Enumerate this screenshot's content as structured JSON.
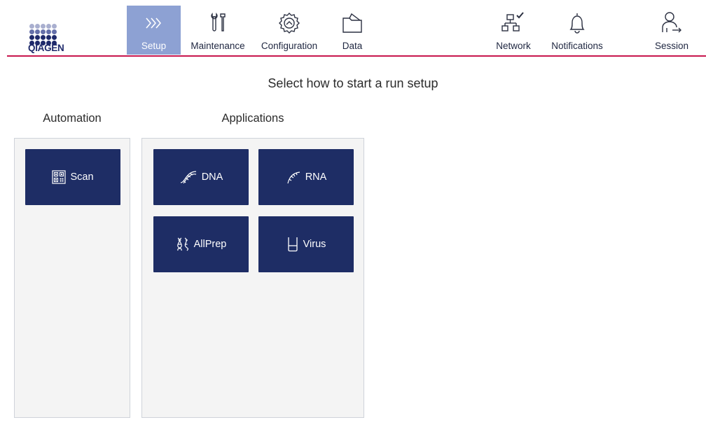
{
  "brand": {
    "name": "QIAGEN",
    "accent_color": "#c8174e",
    "primary_color": "#1e2d65",
    "active_nav_color": "#8da1d3"
  },
  "nav": {
    "setup": {
      "label": "Setup",
      "icon": "chevrons-right-icon"
    },
    "maintenance": {
      "label": "Maintenance",
      "icon": "tools-icon"
    },
    "configuration": {
      "label": "Configuration",
      "icon": "gear-icon"
    },
    "data": {
      "label": "Data",
      "icon": "folder-icon"
    },
    "network": {
      "label": "Network",
      "icon": "network-connected-icon"
    },
    "notifications": {
      "label": "Notifications",
      "icon": "bell-icon"
    },
    "session": {
      "label": "Session",
      "icon": "user-logout-icon"
    }
  },
  "main": {
    "title": "Select how to start a run setup",
    "automation": {
      "heading": "Automation",
      "tiles": [
        {
          "label": "Scan",
          "icon": "qr-code-icon"
        }
      ]
    },
    "applications": {
      "heading": "Applications",
      "tiles": [
        {
          "label": "DNA",
          "icon": "dna-helix-icon"
        },
        {
          "label": "RNA",
          "icon": "rna-strand-icon"
        },
        {
          "label": "AllPrep",
          "icon": "dna-rna-icon"
        },
        {
          "label": "Virus",
          "icon": "test-tube-icon"
        }
      ]
    }
  }
}
